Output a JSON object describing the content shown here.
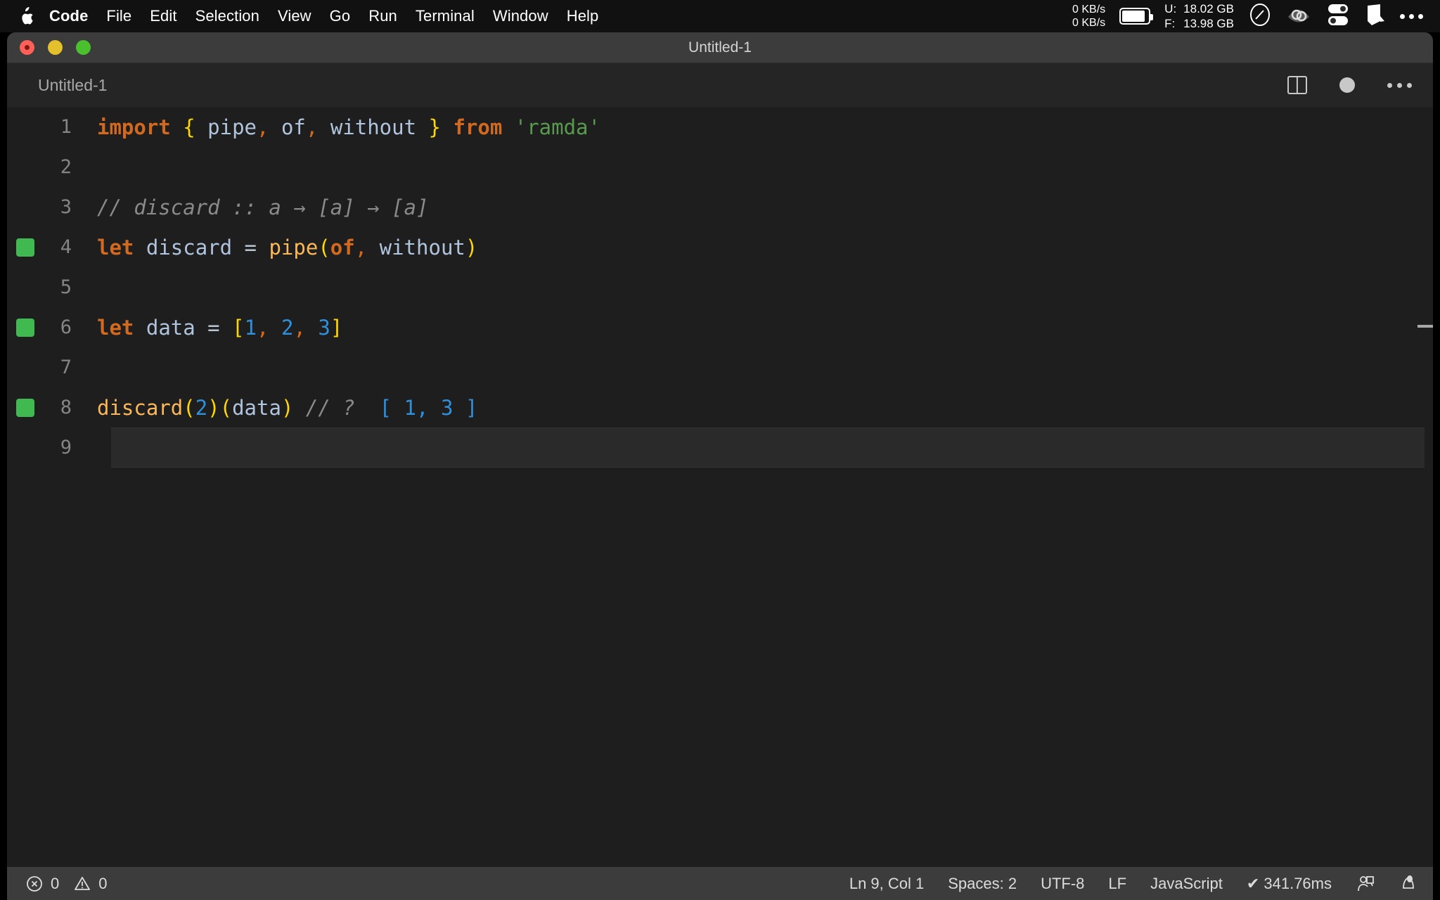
{
  "menubar": {
    "apple_icon": "apple-logo",
    "items": [
      {
        "label": "Code",
        "bold": true
      },
      {
        "label": "File",
        "bold": false
      },
      {
        "label": "Edit",
        "bold": false
      },
      {
        "label": "Selection",
        "bold": false
      },
      {
        "label": "View",
        "bold": false
      },
      {
        "label": "Go",
        "bold": false
      },
      {
        "label": "Run",
        "bold": false
      },
      {
        "label": "Terminal",
        "bold": false
      },
      {
        "label": "Window",
        "bold": false
      },
      {
        "label": "Help",
        "bold": false
      }
    ],
    "network": {
      "up": "0 KB/s",
      "down": "0 KB/s"
    },
    "battery_icon": "battery-icon",
    "memory": {
      "used_label": "U:",
      "used_value": "18.02 GB",
      "free_label": "F:",
      "free_value": "13.98 GB"
    },
    "tray_icons": [
      "gauge-icon",
      "cloud-sync-icon",
      "toggles-icon",
      "shape-icon",
      "ellipsis-icon"
    ]
  },
  "window": {
    "title": "Untitled-1",
    "traffic_lights": [
      "close-button",
      "minimize-button",
      "maximize-button"
    ]
  },
  "editor_header": {
    "tab_label": "Untitled-1",
    "actions": [
      "split-editor-icon",
      "unsaved-dot-icon",
      "more-actions-icon"
    ]
  },
  "editor": {
    "lines": [
      {
        "number": "1",
        "marked": false,
        "current": false,
        "tokens": [
          {
            "text": "import",
            "cls": "t-kw"
          },
          {
            "text": " ",
            "cls": "t-op"
          },
          {
            "text": "{",
            "cls": "t-brace"
          },
          {
            "text": " ",
            "cls": "t-op"
          },
          {
            "text": "pipe",
            "cls": "t-ident"
          },
          {
            "text": ",",
            "cls": "t-punc"
          },
          {
            "text": " ",
            "cls": "t-op"
          },
          {
            "text": "of",
            "cls": "t-ident"
          },
          {
            "text": ",",
            "cls": "t-punc"
          },
          {
            "text": " ",
            "cls": "t-op"
          },
          {
            "text": "without",
            "cls": "t-ident"
          },
          {
            "text": " ",
            "cls": "t-op"
          },
          {
            "text": "}",
            "cls": "t-brace"
          },
          {
            "text": " ",
            "cls": "t-op"
          },
          {
            "text": "from",
            "cls": "t-kw"
          },
          {
            "text": " ",
            "cls": "t-op"
          },
          {
            "text": "'ramda'",
            "cls": "t-str"
          }
        ]
      },
      {
        "number": "2",
        "marked": false,
        "current": false,
        "tokens": []
      },
      {
        "number": "3",
        "marked": false,
        "current": false,
        "tokens": [
          {
            "text": "// discard :: a → [a] → [a]",
            "cls": "t-comment"
          }
        ]
      },
      {
        "number": "4",
        "marked": true,
        "current": false,
        "tokens": [
          {
            "text": "let",
            "cls": "t-kw"
          },
          {
            "text": " ",
            "cls": "t-op"
          },
          {
            "text": "discard",
            "cls": "t-ident"
          },
          {
            "text": " = ",
            "cls": "t-op"
          },
          {
            "text": "pipe",
            "cls": "t-fn"
          },
          {
            "text": "(",
            "cls": "t-brace"
          },
          {
            "text": "of",
            "cls": "t-kw"
          },
          {
            "text": ",",
            "cls": "t-punc"
          },
          {
            "text": " ",
            "cls": "t-op"
          },
          {
            "text": "without",
            "cls": "t-ident"
          },
          {
            "text": ")",
            "cls": "t-brace"
          }
        ]
      },
      {
        "number": "5",
        "marked": false,
        "current": false,
        "tokens": []
      },
      {
        "number": "6",
        "marked": true,
        "current": false,
        "tokens": [
          {
            "text": "let",
            "cls": "t-kw"
          },
          {
            "text": " ",
            "cls": "t-op"
          },
          {
            "text": "data",
            "cls": "t-ident"
          },
          {
            "text": " = ",
            "cls": "t-op"
          },
          {
            "text": "[",
            "cls": "t-brace"
          },
          {
            "text": "1",
            "cls": "t-num"
          },
          {
            "text": ",",
            "cls": "t-punc"
          },
          {
            "text": " ",
            "cls": "t-op"
          },
          {
            "text": "2",
            "cls": "t-num"
          },
          {
            "text": ",",
            "cls": "t-punc"
          },
          {
            "text": " ",
            "cls": "t-op"
          },
          {
            "text": "3",
            "cls": "t-num"
          },
          {
            "text": "]",
            "cls": "t-brace"
          }
        ]
      },
      {
        "number": "7",
        "marked": false,
        "current": false,
        "tokens": []
      },
      {
        "number": "8",
        "marked": true,
        "current": false,
        "tokens": [
          {
            "text": "discard",
            "cls": "t-fn"
          },
          {
            "text": "(",
            "cls": "t-brace"
          },
          {
            "text": "2",
            "cls": "t-num"
          },
          {
            "text": ")",
            "cls": "t-brace"
          },
          {
            "text": "(",
            "cls": "t-brace"
          },
          {
            "text": "data",
            "cls": "t-ident"
          },
          {
            "text": ")",
            "cls": "t-brace"
          },
          {
            "text": " ",
            "cls": "t-op"
          },
          {
            "text": "// ?",
            "cls": "t-comment"
          },
          {
            "text": "  ",
            "cls": "t-op"
          },
          {
            "text": "[ 1, 3 ]",
            "cls": "t-blue"
          }
        ]
      },
      {
        "number": "9",
        "marked": false,
        "current": true,
        "tokens": []
      }
    ]
  },
  "statusbar": {
    "errors_icon": "error-circle-icon",
    "errors_count": "0",
    "warnings_icon": "warning-triangle-icon",
    "warnings_count": "0",
    "cursor_position": "Ln 9, Col 1",
    "indentation": "Spaces: 2",
    "encoding": "UTF-8",
    "eol": "LF",
    "language": "JavaScript",
    "timing_check": "✔",
    "timing": "341.76ms",
    "remote_icon": "screencast-icon",
    "bell_icon": "bell-icon"
  },
  "colors": {
    "editor_bg": "#1e1e1e",
    "titlebar_bg": "#3c3c3c",
    "marker_green": "#3fb950",
    "accent_orange": "#d2691e",
    "brace_yellow": "#ffd700",
    "number_blue": "#2f8fd8",
    "string_green": "#579c4c"
  }
}
